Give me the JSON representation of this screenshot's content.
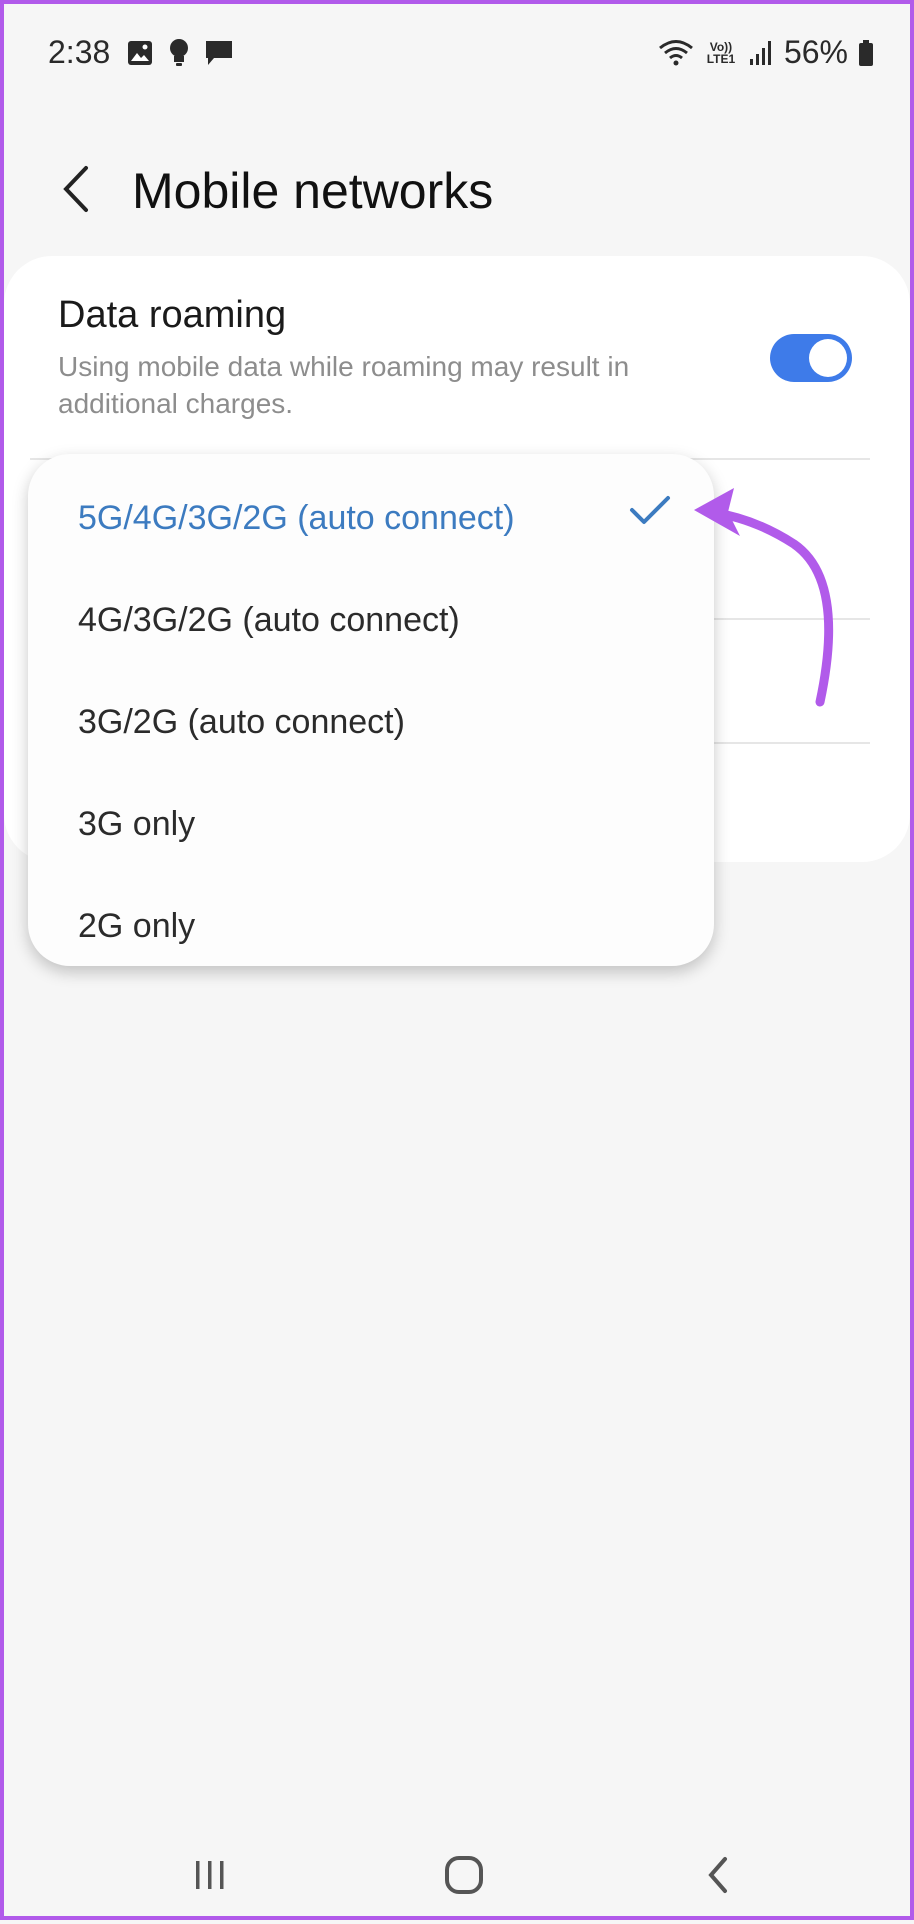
{
  "status_bar": {
    "time": "2:38",
    "battery": "56%",
    "volte": "Vo)) LTE1"
  },
  "header": {
    "title": "Mobile networks"
  },
  "data_roaming": {
    "title": "Data roaming",
    "description": "Using mobile data while roaming may result in additional charges.",
    "enabled": true,
    "accent_color": "#3e7be9"
  },
  "network_mode": {
    "options": [
      {
        "label": "5G/4G/3G/2G (auto connect)",
        "selected": true
      },
      {
        "label": "4G/3G/2G (auto connect)",
        "selected": false
      },
      {
        "label": "3G/2G (auto connect)",
        "selected": false
      },
      {
        "label": "3G only",
        "selected": false
      },
      {
        "label": "2G only",
        "selected": false
      }
    ],
    "selected_color": "#3c7bc0"
  },
  "annotation": {
    "arrow_color": "#b15bea"
  },
  "nav_bar": {
    "icons": [
      "recent-apps-icon",
      "home-icon",
      "back-icon"
    ]
  }
}
